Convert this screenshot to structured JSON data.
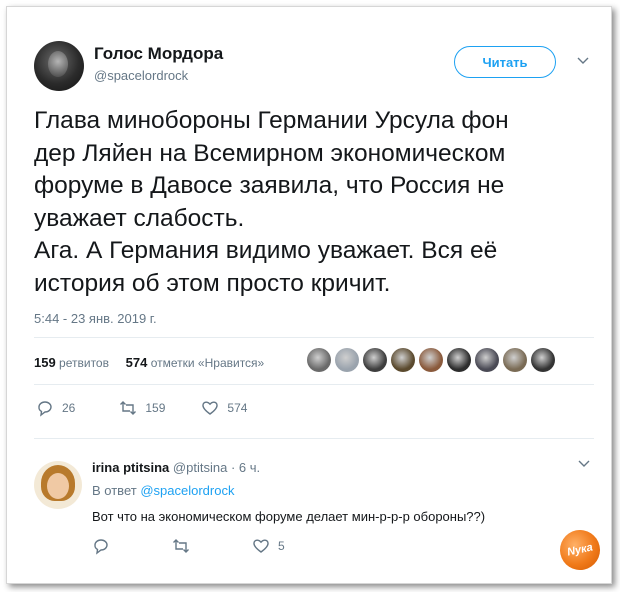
{
  "author": {
    "name": "Голос Мордора",
    "handle": "@spacelordrock"
  },
  "follow_label": "Читать",
  "tweet_lines": [
    "Глава минобороны Германии Урсула фон",
    "дер Ляйен на Всемирном экономическом",
    "форуме в Давосе заявила, что Россия не",
    "уважает слабость.",
    "Ага. А Германия видимо уважает. Вся её",
    "история об этом просто кричит."
  ],
  "timestamp": "5:44 - 23 янв. 2019 г.",
  "stats": {
    "retweets_count": "159",
    "retweets_label": "ретвитов",
    "likes_count": "574",
    "likes_label": "отметки «Нравится»"
  },
  "likers_colors": [
    "#6a6a6a",
    "#9aa3ad",
    "#3e3e3e",
    "#5b4a2e",
    "#8a5a3c",
    "#2d2d2d",
    "#4a4a55",
    "#7a6b55",
    "#333333"
  ],
  "actions": {
    "replies": "26",
    "retweets": "159",
    "likes": "574"
  },
  "reply": {
    "name": "irina ptitsina",
    "handle": "@ptitsina",
    "time": "· 6 ч.",
    "in_reply_prefix": "В ответ",
    "in_reply_handle": "@spacelordrock",
    "text": "Вот что на экономическом форуме делает мин-р-р-р обороны??)",
    "likes": "5"
  },
  "watermark_text": "Νука",
  "colors": {
    "accent": "#1da1f2",
    "muted": "#657786",
    "text": "#14171a"
  }
}
